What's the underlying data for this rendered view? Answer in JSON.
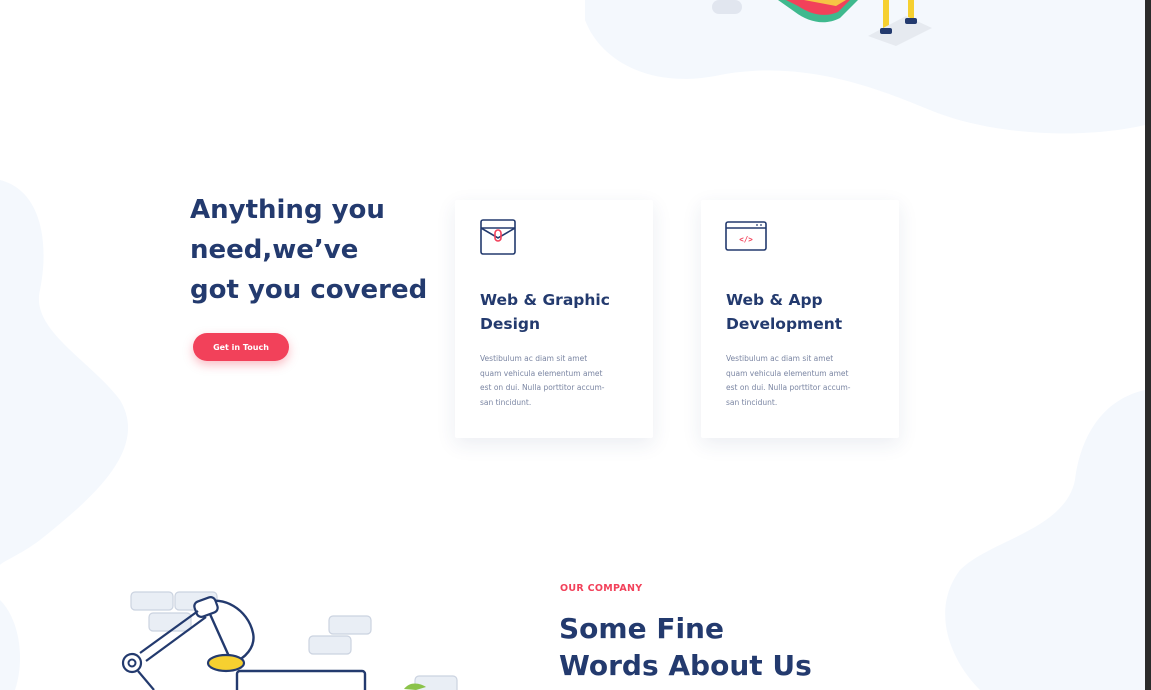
{
  "hero": {
    "title_lines": [
      "Anything you",
      "need,we’ve",
      "got you covered"
    ],
    "cta_label": "Get in Touch"
  },
  "services": [
    {
      "icon": "envelope-icon",
      "title_lines": [
        "Web & Graphic",
        "Design"
      ],
      "body_lines": [
        "Vestibulum ac diam sit amet",
        "quam vehicula elementum amet",
        "est on dui. Nulla porttitor accum-",
        "san tincidunt."
      ]
    },
    {
      "icon": "browser-code-icon",
      "title_lines": [
        "Web & App",
        "Development"
      ],
      "body_lines": [
        "Vestibulum ac diam sit amet",
        "quam vehicula elementum amet",
        "est on dui. Nulla porttitor accum-",
        "san tincidunt."
      ],
      "icon_glyph": "</>"
    }
  ],
  "about": {
    "eyebrow": "OUR COMPANY",
    "title_lines": [
      "Some Fine",
      "Words About Us"
    ]
  },
  "colors": {
    "navy": "#233a6e",
    "accent": "#f2415a",
    "body_text": "#7b86a3",
    "blob": "#f4f8fd"
  }
}
